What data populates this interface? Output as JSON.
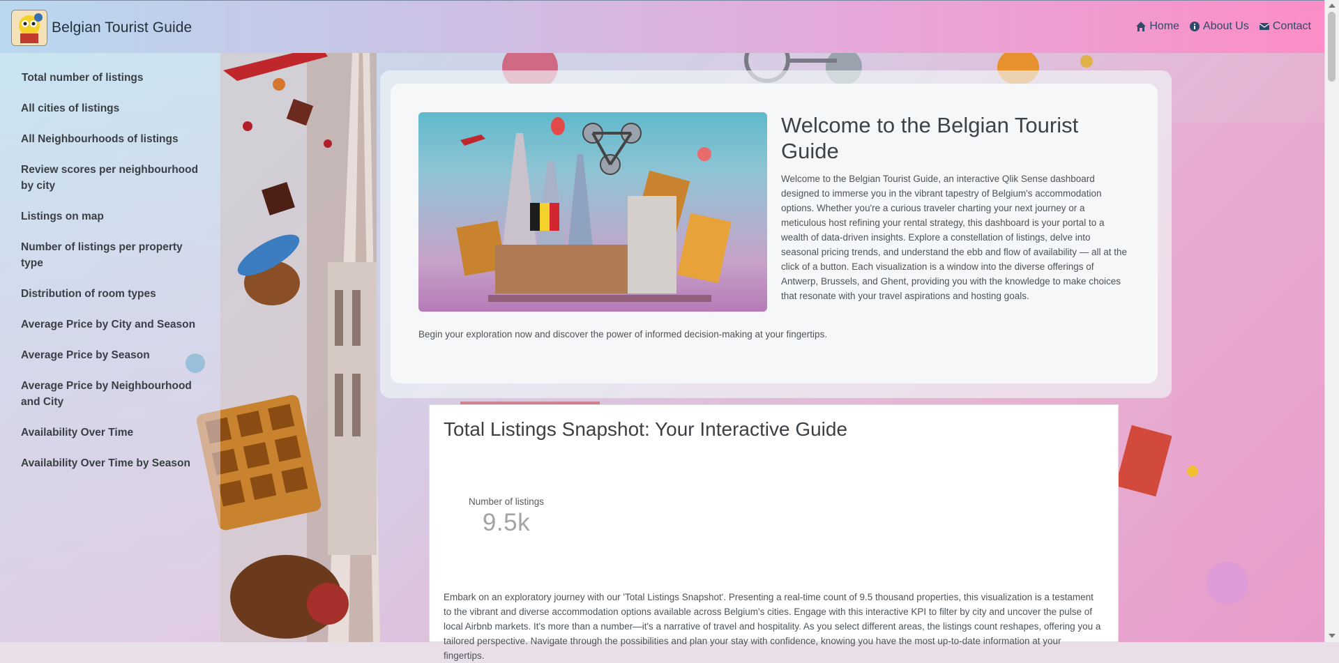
{
  "app": {
    "title": "Belgian Tourist Guide"
  },
  "nav": {
    "links": [
      {
        "label": "Home",
        "icon": "home-icon"
      },
      {
        "label": "About Us",
        "icon": "info-icon"
      },
      {
        "label": "Contact",
        "icon": "envelope-icon"
      }
    ]
  },
  "sidebar": {
    "items": [
      {
        "label": "Total number of listings"
      },
      {
        "label": "All cities of listings"
      },
      {
        "label": "All Neighbourhoods of listings"
      },
      {
        "label": "Review scores per neighbourhood by city"
      },
      {
        "label": "Listings on map"
      },
      {
        "label": "Number of listings per property type"
      },
      {
        "label": "Distribution of room types"
      },
      {
        "label": "Average Price by City and Season"
      },
      {
        "label": "Average Price by Season"
      },
      {
        "label": "Average Price by Neighbourhood and City"
      },
      {
        "label": "Availability Over Time"
      },
      {
        "label": "Availability Over Time by Season"
      }
    ]
  },
  "welcome": {
    "title": "Welcome to the Belgian Tourist Guide",
    "body": "Welcome to the Belgian Tourist Guide, an interactive Qlik Sense dashboard designed to immerse you in the vibrant tapestry of Belgium's accommodation options. Whether you're a curious traveler charting your next journey or a meticulous host refining your rental strategy, this dashboard is your portal to a wealth of data-driven insights. Explore a constellation of listings, delve into seasonal pricing trends, and understand the ebb and flow of availability — all at the click of a button. Each visualization is a window into the diverse offerings of Antwerp, Brussels, and Ghent, providing you with the knowledge to make choices that resonate with your travel aspirations and hosting goals.",
    "cta": "Begin your exploration now and discover the power of informed decision-making at your fingertips."
  },
  "snapshot": {
    "title": "Total Listings Snapshot: Your Interactive Guide",
    "kpi_label": "Number of listings",
    "kpi_value": "9.5k",
    "body": "Embark on an exploratory journey with our 'Total Listings Snapshot'. Presenting a real-time count of 9.5 thousand properties, this visualization is a testament to the vibrant and diverse accommodation options available across Belgium's cities. Engage with this interactive KPI to filter by city and uncover the pulse of local Airbnb markets. It's more than a number—it's a narrative of travel and hospitality. As you select different areas, the listings count reshapes, offering you a tailored perspective. Navigate through the possibilities and plan your stay with confidence, knowing you have the most up-to-date information at your fingertips."
  },
  "colors": {
    "nav_gradient_start": "#b9d8ef",
    "nav_gradient_end": "#fb8ec6",
    "nav_link": "#2e4a69",
    "kpi_value": "#a3a3a3"
  }
}
